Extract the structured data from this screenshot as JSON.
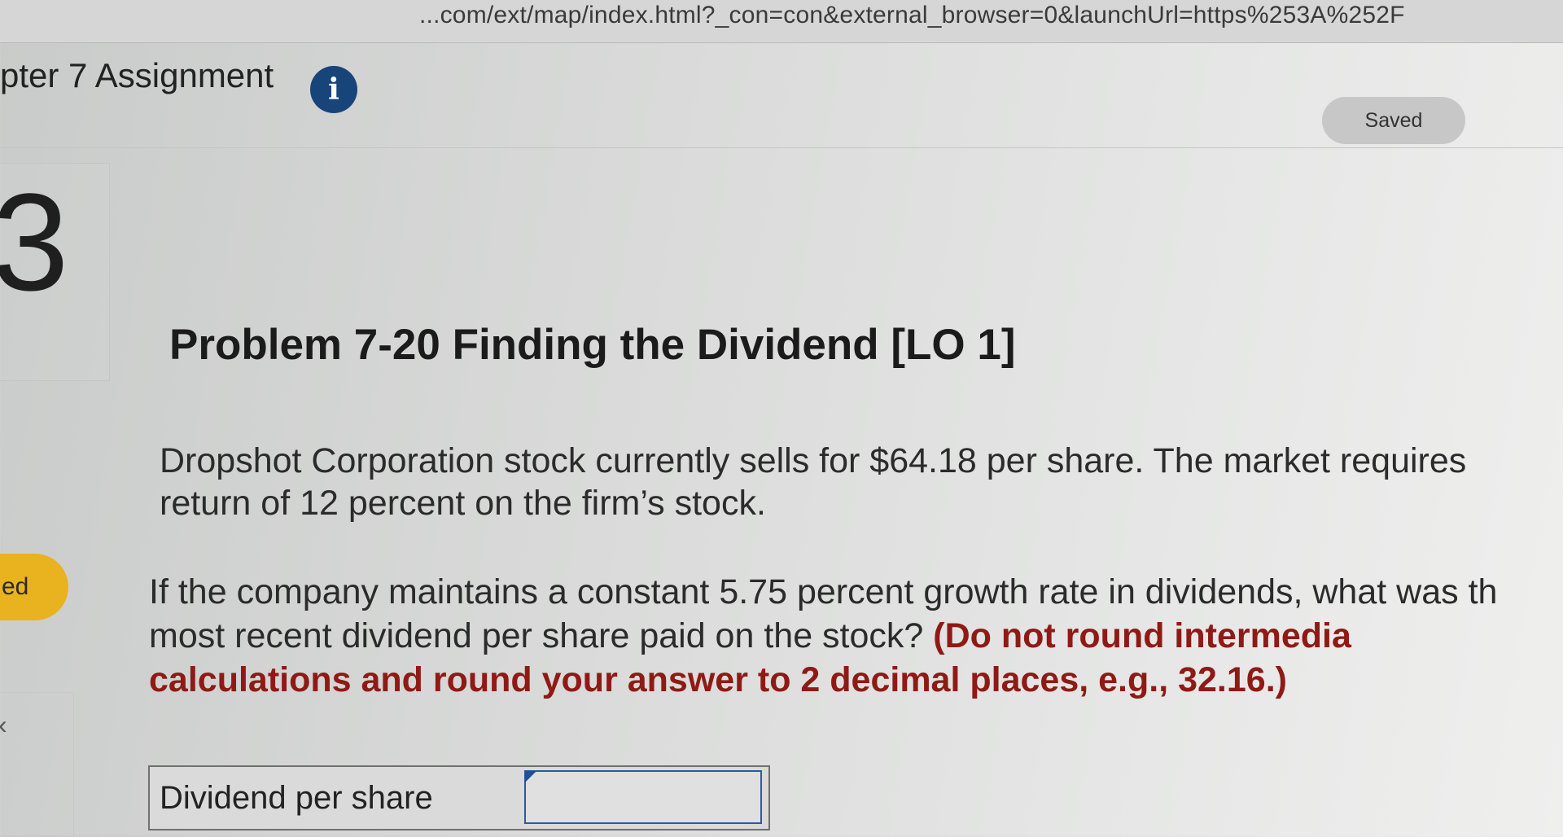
{
  "browser": {
    "url": "...com/ext/map/index.html?_con=con&external_browser=0&launchUrl=https%253A%252F"
  },
  "header": {
    "title": "pter 7 Assignment",
    "info_icon": "i",
    "saved_label": "Saved"
  },
  "question_nav": {
    "number": "3",
    "status_badge": "ed",
    "chevron": "‹"
  },
  "problem": {
    "title": "Problem 7-20 Finding the Dividend [LO 1]",
    "paragraph1": "Dropshot Corporation stock currently sells for $64.18 per share. The market requires return of 12 percent on the firm’s stock.",
    "paragraph2": "If the company maintains a constant 5.75 percent growth rate in dividends, what was th most recent dividend per share paid on the stock?",
    "instruction": "(Do not round intermedia calculations and round your answer to 2 decimal places, e.g., 32.16.)"
  },
  "answer": {
    "label": "Dividend per share",
    "value": ""
  }
}
